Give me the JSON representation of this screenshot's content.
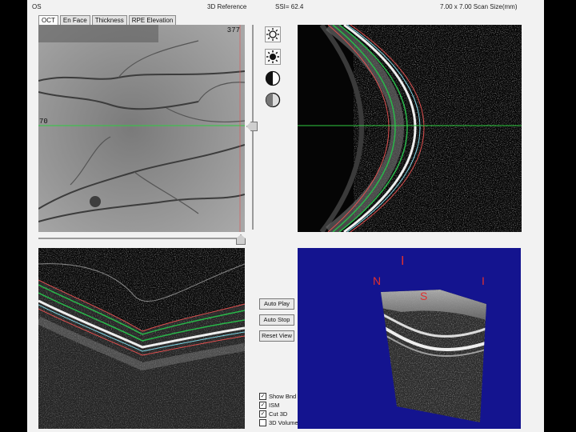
{
  "header": {
    "eye": "OS",
    "mode": "3D Reference",
    "ssi": "SSI= 62.4",
    "scan_size": "7.00 x 7.00 Scan Size(mm)"
  },
  "tabs": [
    {
      "label": "OCT",
      "active": true
    },
    {
      "label": "En Face",
      "active": false
    },
    {
      "label": "Thickness",
      "active": false
    },
    {
      "label": "RPE Elevation",
      "active": false
    }
  ],
  "fundus": {
    "frame_number": "377",
    "line_number": "70"
  },
  "toolbar": [
    {
      "icon": "brightness-up-icon"
    },
    {
      "icon": "brightness-down-icon"
    },
    {
      "icon": "contrast-icon"
    },
    {
      "icon": "gray-contrast-icon"
    }
  ],
  "buttons": {
    "auto_play": "Auto Play",
    "auto_stop": "Auto Stop",
    "reset_view": "Reset View"
  },
  "checkboxes": [
    {
      "label": "Show Bnd",
      "checked": true
    },
    {
      "label": "ISM",
      "checked": true
    },
    {
      "label": "Cut 3D",
      "checked": true
    },
    {
      "label": "3D Volume",
      "checked": false
    }
  ],
  "orientation_labels": {
    "top": "I",
    "left": "N",
    "center": "S",
    "right": "I"
  },
  "colors": {
    "scan_line": "#2ecc40",
    "boundary_green": "#29b84a",
    "boundary_red": "#e05050",
    "boundary_cyan": "#7fd8e8",
    "render_background": "#14148f"
  }
}
